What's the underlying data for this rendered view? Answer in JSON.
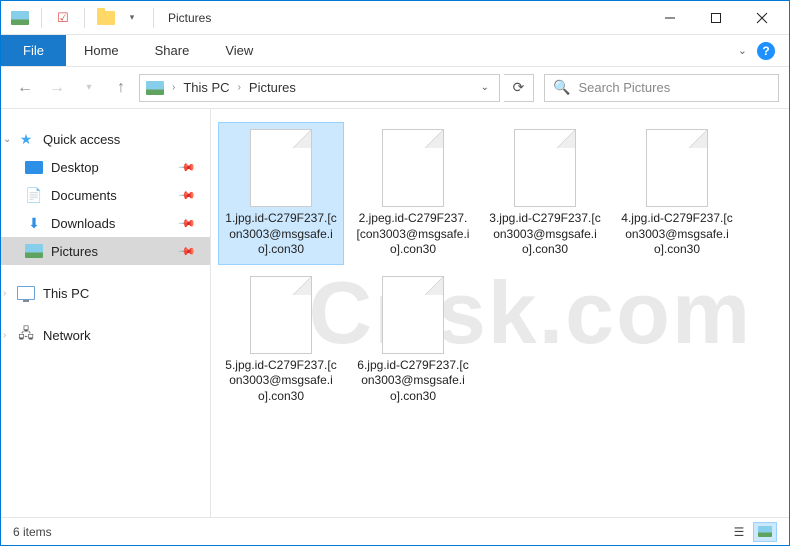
{
  "title": "Pictures",
  "ribbon": {
    "file": "File",
    "tabs": [
      "Home",
      "Share",
      "View"
    ]
  },
  "breadcrumb": {
    "root_hint": " ",
    "crumb1": "This PC",
    "crumb2": "Pictures"
  },
  "search": {
    "placeholder": "Search Pictures"
  },
  "sidebar": {
    "quick_access": "Quick access",
    "items": [
      {
        "label": "Desktop",
        "pinned": true
      },
      {
        "label": "Documents",
        "pinned": true
      },
      {
        "label": "Downloads",
        "pinned": true
      },
      {
        "label": "Pictures",
        "pinned": true,
        "selected": true
      }
    ],
    "this_pc": "This PC",
    "network": "Network"
  },
  "files": [
    {
      "name": "1.jpg.id-C279F237.[con3003@msgsafe.io].con30",
      "selected": true
    },
    {
      "name": "2.jpeg.id-C279F237.[con3003@msgsafe.io].con30"
    },
    {
      "name": "3.jpg.id-C279F237.[con3003@msgsafe.io].con30"
    },
    {
      "name": "4.jpg.id-C279F237.[con3003@msgsafe.io].con30"
    },
    {
      "name": "5.jpg.id-C279F237.[con3003@msgsafe.io].con30"
    },
    {
      "name": "6.jpg.id-C279F237.[con3003@msgsafe.io].con30"
    }
  ],
  "status": {
    "count": "6 items"
  },
  "watermark": "PCrisk.com"
}
